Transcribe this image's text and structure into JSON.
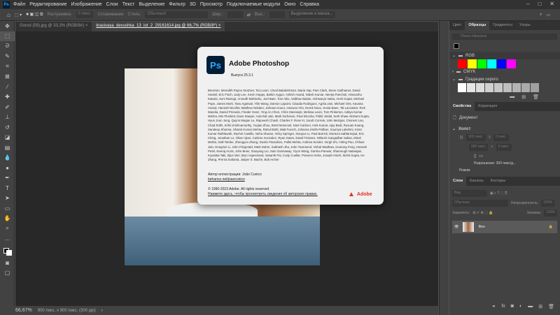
{
  "menu": {
    "logo": "Ps",
    "items": [
      "Файл",
      "Редактирование",
      "Изображение",
      "Слои",
      "Текст",
      "Выделение",
      "Фильтр",
      "3D",
      "Просмотр",
      "Подключаемые модули",
      "Окно",
      "Справка"
    ]
  },
  "window_controls": {
    "minimize": "–",
    "maximize": "□",
    "close": "✕"
  },
  "options": {
    "feather_label": "Растушевка:",
    "feather_value": "0 пикс.",
    "antialias": "Сглаживание",
    "style_label": "Стиль:",
    "style_value": "Обычный",
    "width_label": "Шир.:",
    "height_label": "Выс.:",
    "select_mask": "Выделение и маска..."
  },
  "tabs": [
    {
      "label": "Gorod (59).jpg @ 33,3% (RGB/8#)",
      "close": "×"
    },
    {
      "label": "krasivaya_devushka_13_iot_2_29161614.jpg @ 66,7% (RGB/8*)",
      "close": "×"
    }
  ],
  "about": {
    "logo": "Ps",
    "title": "Adobe Photoshop",
    "version": "Выпуск 25.3.1",
    "credits": "Brereton, Meredith Payne Stotzner, Tai Luxon, Vinod Balakrishnan, Maria Yap, Pam Clark, Steve Guilhamet, David Hackel, Eric Floch, Judy Lee, Kevin Hopps, Barkin Aygun, Ashish Anand, Nitesh Kumar, Neerja Pancholi, Himanshu Kataria, Soni Rastogi, Anirudh Mahindru, Joel Baer, Tom Attix, Vaibhav Balain, Aishwarya Vatsa, Ansh Gupta, Michael Pope, James Mork, Tanu Agarwal, Yilin Wang, Damon Lapoint, Claudia Rodriguez, Agrita Jain, Michael Orts, Kavana Anand, Hannah Nicollet, Matthew Neldam, Jahnavi Gouru, Heewoo Ahn, Derek Novo, Sonia Baee, Tal Lancaster, Rick Mandia, Daniel Presedo, Frieder Ganz, Ying-An Chen, Chris Steenwyk, Melissa Levin, Tom Pinkerton, Aditya Kumar Mishra, Min Plunkett, Dave Sawyer, Aanchal Jain, Mark Nichoson, Paul Kleczka, Pulkit Jindal, Seth Shaw, Nishant Gupta, Hyun Joon Jung, Quynn Megan Le, Rajneesh Chavli, Charles F. Rose III, Jacob Correia, John Metzger, Clement Lan, Chad Rolfs, Kirthi Krishnamurthy, Yuqian Zhou, Brett Nemecek, Noel Carboni, Amit Kumar, Ajay Bedi, Ruxuan Kuang, Sandeep Sharma, Shamit Kumar Mehta, Rahul Bisht, Matt Fuerch, Johanna Smith-Palliser, Soumya Lakshmi, Kiran Kumar Rathlavath, Rachel Castillo, Neha Sharan, Vicky Springer, Xiaoyue Li, Paul Barrick, Morteza Safdarnejad, Eric Ching, Jonathan Lo, Oliver Qian, Carlene Gonzalez, Ryan Gates, David Tristram, Nithesh Gangadhar Salian, Minal Mehta, Salil Tambe, Zhengyun Zhang, Dustin Passofaro, Pulkit Mehta, Andrew Sender, Vergil Shi, I-Ming Pao, Chhavi Jain, Dongmei Li, John Fitzgerald, Mark Dahm, Subhash Jha, John Townsend, Vishal Wadhwa, Guotong Feng, Hannah Pearl, Neeraj Arora, John Beier, Xiaoyang Liu, Sam Gannaway, Yiyun Wang, Garima Panwar, Shanmugh Natarajan, Kiyotaka Taki, Zijun Wei, Bryn Aspestrand, Vasanth Pai, Cody Cuellar, Praveen Gelra, Joseph Hsieh, Mohit Gupta, He Zhang, Prerna Sultania, Jasper S. Bache, Bob Archer",
    "illustration_author": "Автор иллюстрации: João Cunico",
    "illustration_link": "behance.net/joaocunico",
    "copyright": "© 1990-2023 Adobe. All rights reserved.",
    "legal_link": "Нажмите здесь, чтобы просмотреть сведения об авторских правах.",
    "brand": "Adobe"
  },
  "status": {
    "zoom": "66,67%",
    "doc_info": "900 пикс. x 900 пикс. (300 ppi)",
    "arrow": "›"
  },
  "swatches_panel": {
    "tabs": [
      "Цвет",
      "Образцы",
      "Градиенты",
      "Узоры"
    ],
    "search_placeholder": "Поиск образцов",
    "groups": [
      {
        "name": "RGB",
        "colors": [
          "#ff0000",
          "#ffff00",
          "#00ff00",
          "#00ffff",
          "#0000ff",
          "#ff00ff"
        ]
      },
      {
        "name": "CMYK",
        "colors": []
      },
      {
        "name": "Градации серого",
        "colors": [
          "#ffffff",
          "#e6e6e6",
          "#dcdcdc",
          "#d0d0d0",
          "#c8c8c8",
          "#bebebe",
          "#b4b4b4",
          "#aaaaaa",
          "#a0a0a0"
        ]
      }
    ]
  },
  "properties_panel": {
    "tabs": [
      "Свойства",
      "Коррекция"
    ],
    "doc": "Документ",
    "section": "Холст",
    "w": "900 пикс.",
    "h": "900 пикс.",
    "x_label": "X",
    "y_label": "Y",
    "x": "0 пикс.",
    "y": "0 пикс.",
    "resolution": "Разрешение: 300 пикс/д...",
    "mode": "Режим"
  },
  "layers_panel": {
    "tabs": [
      "Слои",
      "Каналы",
      "Контуры"
    ],
    "search": "Вид",
    "blend": "Обычные",
    "opacity_label": "Непрозрачность:",
    "opacity": "100%",
    "lock_label": "Закрепить:",
    "fill_label": "Заливка:",
    "fill": "100%",
    "layers": [
      {
        "name": "Фон"
      }
    ]
  }
}
